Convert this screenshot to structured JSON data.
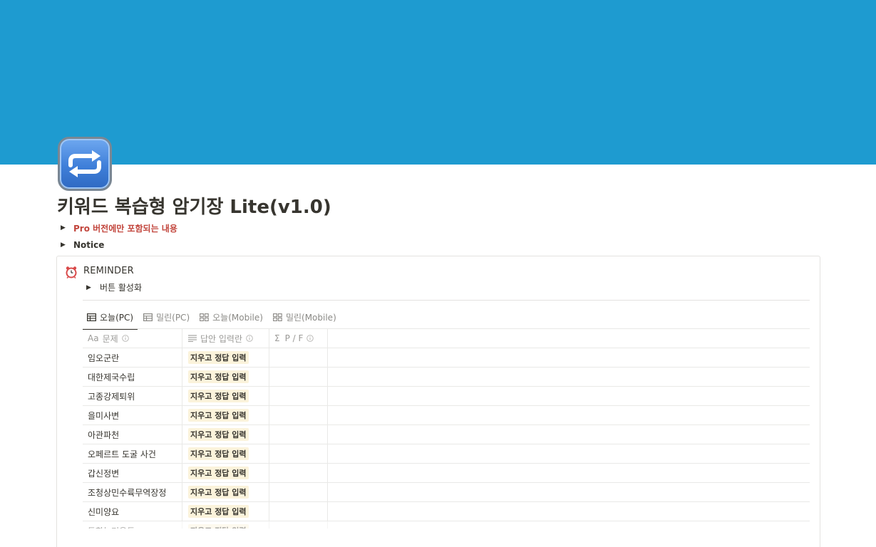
{
  "page": {
    "title": "키워드 복습형 암기장 Lite(v1.0)",
    "icon": "repeat-button-icon",
    "cover_color": "#1e9bd0"
  },
  "toggles": [
    {
      "label": "Pro 버전에만 포함되는 내용",
      "color": "#c2453c"
    },
    {
      "label": "Notice"
    }
  ],
  "callout": {
    "icon": "alarm-clock-icon",
    "title": "REMINDER",
    "toggle_label": "버튼 활성화"
  },
  "tabs": [
    {
      "label": "오늘(PC)",
      "icon": "table-icon",
      "active": true
    },
    {
      "label": "밀린(PC)",
      "icon": "table-icon",
      "active": false
    },
    {
      "label": "오늘(Mobile)",
      "icon": "gallery-icon",
      "active": false
    },
    {
      "label": "밀린(Mobile)",
      "icon": "gallery-icon",
      "active": false
    }
  ],
  "table": {
    "columns": [
      {
        "label": "문제",
        "icon": "title-icon",
        "prefix": "Aa"
      },
      {
        "label": "답안 입력란",
        "icon": "text-lines-icon"
      },
      {
        "label": "P / F",
        "icon": "formula-icon",
        "prefix": "Σ"
      }
    ],
    "answer_button_label": "지우고 정답 입력",
    "rows": [
      "임오군란",
      "대한제국수립",
      "고종강제퇴위",
      "을미사변",
      "아관파천",
      "오페르트 도굴 사건",
      "갑신정변",
      "조청상민수륙무역장정",
      "신미양요",
      "동학농민운동"
    ]
  }
}
